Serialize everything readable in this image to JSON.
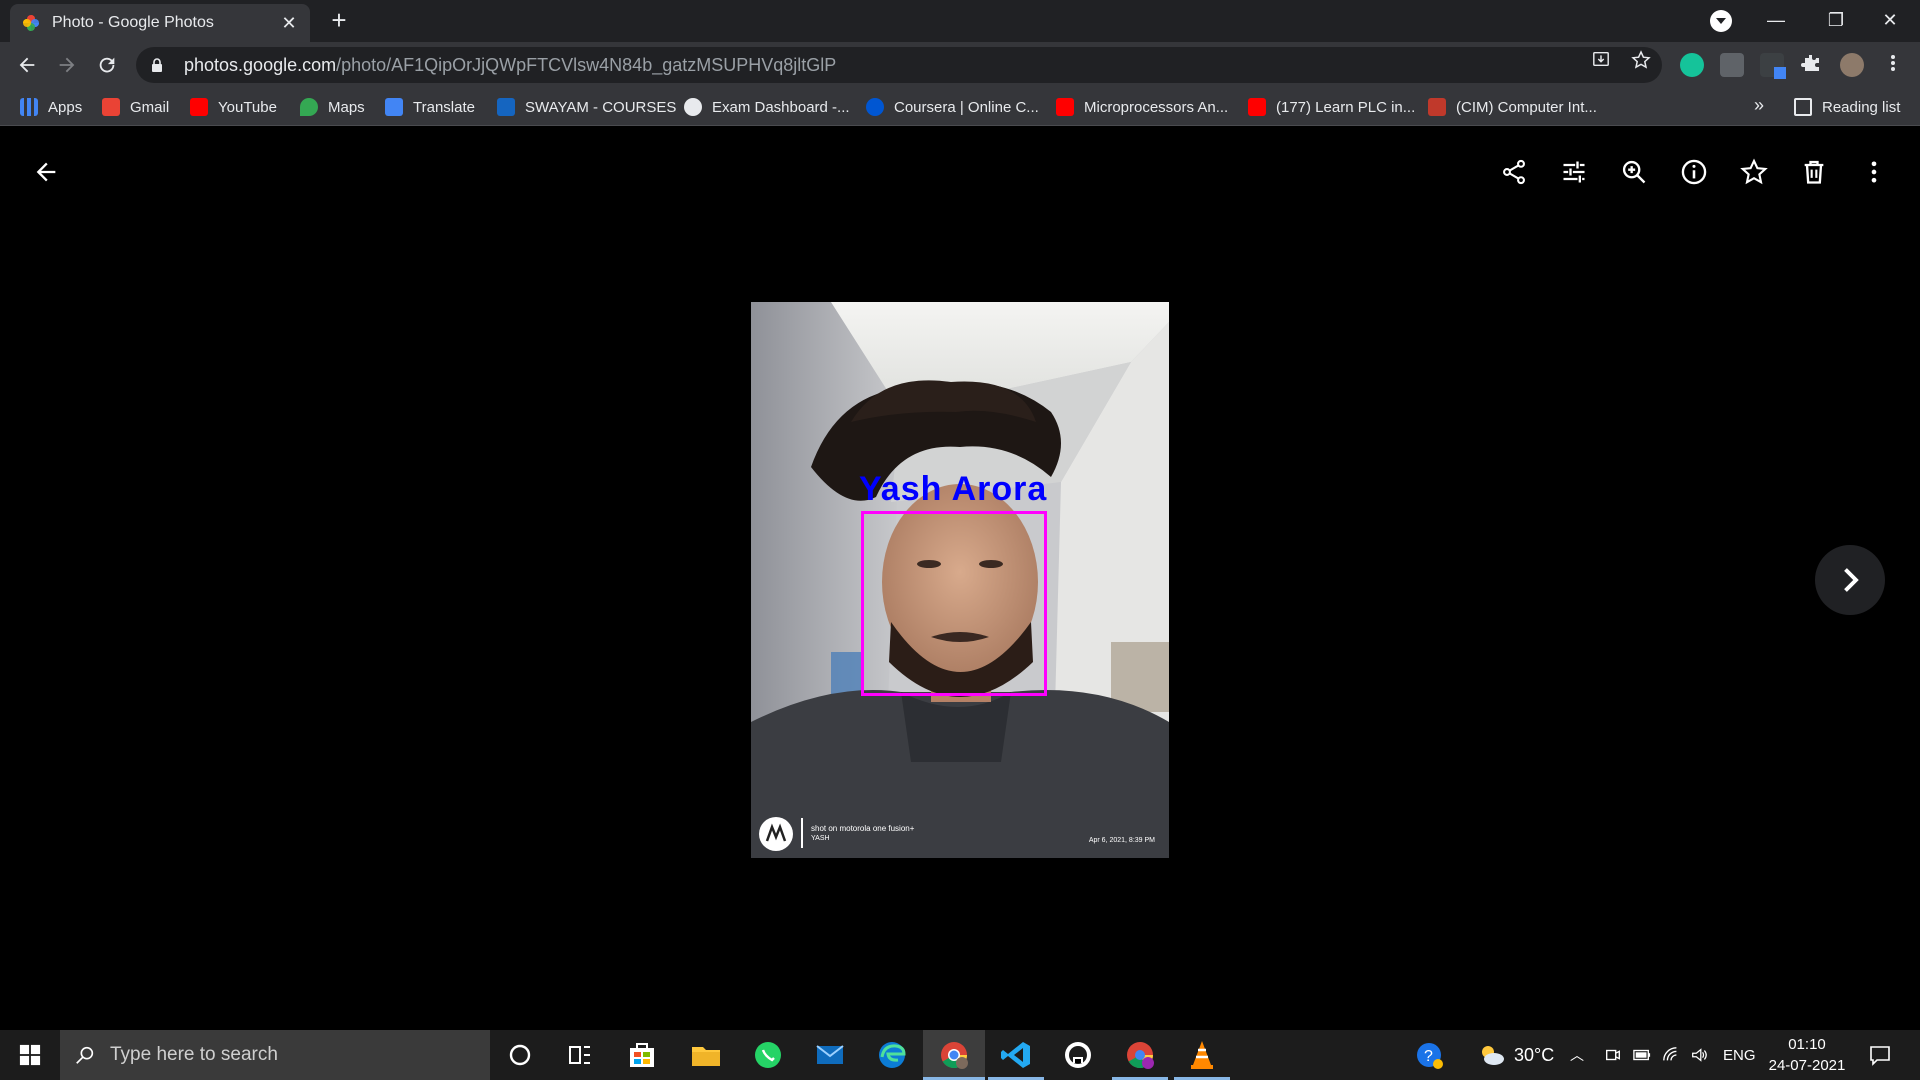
{
  "browser": {
    "tab_title": "Photo - Google Photos",
    "tab_close": "✕",
    "new_tab": "+",
    "window": {
      "minimize": "—",
      "restore": "❐",
      "close": "✕"
    }
  },
  "toolbar": {
    "url_host": "photos.google.com",
    "url_path": "/photo/AF1QipOrJjQWpFTCVlsw4N84b_gatzMSUPHVq8jltGlP"
  },
  "bookmarks": {
    "items": [
      {
        "label": "Apps",
        "color": "#4285f4"
      },
      {
        "label": "Gmail",
        "color": "#ea4335"
      },
      {
        "label": "YouTube",
        "color": "#ff0000"
      },
      {
        "label": "Maps",
        "color": "#34a853"
      },
      {
        "label": "Translate",
        "color": "#4285f4"
      },
      {
        "label": "SWAYAM - COURSES",
        "color": "#1565c0"
      },
      {
        "label": "Exam Dashboard -...",
        "color": "#e8eaed"
      },
      {
        "label": "Coursera | Online C...",
        "color": "#0056d2"
      },
      {
        "label": "Microprocessors An...",
        "color": "#ff0000"
      },
      {
        "label": "(177) Learn PLC in...",
        "color": "#ff0000"
      },
      {
        "label": "(CIM) Computer Int...",
        "color": "#c0392b"
      }
    ],
    "more": "»",
    "reading_list": "Reading list"
  },
  "photo": {
    "face_label": "Yash Arora",
    "watermark_line1": "shot on motorola one fusion+",
    "watermark_line2": "YASH",
    "watermark_date": "Apr 6, 2021, 8:39 PM"
  },
  "taskbar": {
    "search_placeholder": "Type here to search",
    "weather": "30°C",
    "language": "ENG",
    "time": "01:10",
    "date": "24-07-2021"
  },
  "colors": {
    "face_box": "#ff00ff",
    "face_label": "#0000ff",
    "chrome_dark": "#202124",
    "chrome_mid": "#35363a"
  }
}
